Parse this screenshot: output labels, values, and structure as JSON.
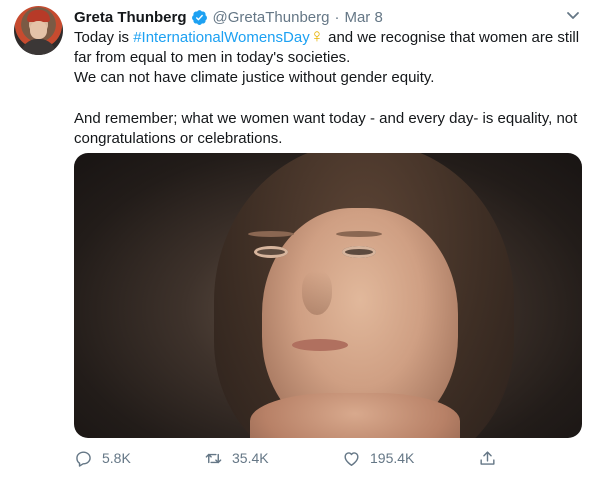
{
  "tweet": {
    "author_name": "Greta Thunberg",
    "handle": "@GretaThunberg",
    "separator": "·",
    "date": "Mar 8",
    "text": {
      "line1_prefix": "Today is ",
      "hashtag": "#InternationalWomensDay",
      "emoji": "♀",
      "line1_suffix": " and we recognise that women are still",
      "line2": "far from equal to men in today's societies.",
      "line3": "We can not have climate justice without gender equity.",
      "line4": "And remember; what we women want today - and every day- is equality, not",
      "line5": "congratulations or celebrations."
    },
    "actions": {
      "reply_count": "5.8K",
      "retweet_count": "35.4K",
      "like_count": "195.4K"
    }
  },
  "icons": {
    "verified": "verified-badge-icon",
    "more": "chevron-down-icon",
    "reply": "reply-icon",
    "retweet": "retweet-icon",
    "like": "heart-icon",
    "share": "share-icon"
  },
  "colors": {
    "link": "#1da1f2",
    "secondary_text": "#657786",
    "primary_text": "#14171a",
    "verified": "#1da1f2"
  }
}
